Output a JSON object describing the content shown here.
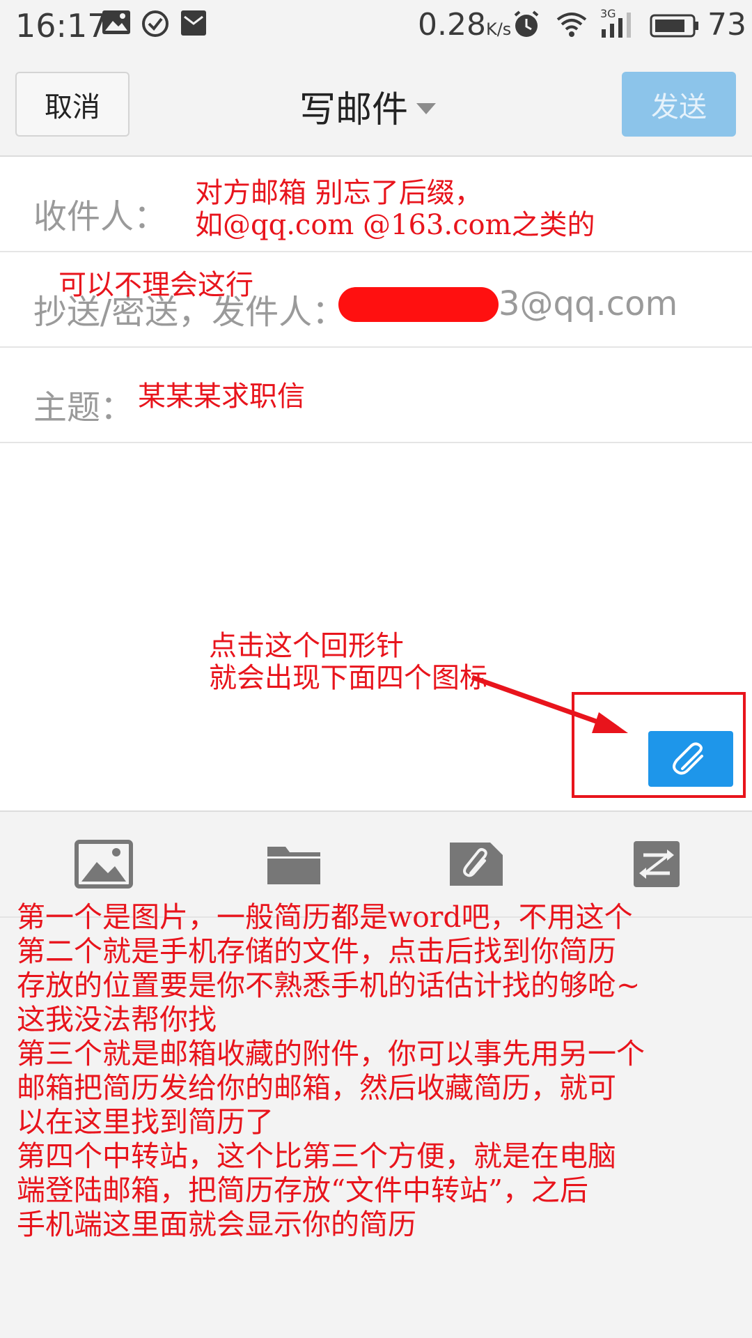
{
  "status_bar": {
    "time": "16:17",
    "net_speed": "0.28",
    "net_speed_unit": "K/s",
    "network_type": "3G",
    "battery_level": "73",
    "icons": [
      "image-icon",
      "check-circle-icon",
      "mail-notification-icon",
      "alarm-icon",
      "wifi-icon",
      "signal-icon",
      "battery-icon"
    ]
  },
  "top_bar": {
    "cancel_label": "取消",
    "title": "写邮件",
    "send_label": "发送"
  },
  "form": {
    "to_label": "收件人：",
    "cc_label": "抄送/密送，发件人：",
    "cc_value_visible": "3@qq.com",
    "subject_label": "主题："
  },
  "annotations": {
    "to_note": "对方邮箱 别忘了后缀，\n如@qq.com @163.com之类的",
    "cc_note": "可以不理会这行",
    "subject_note": "某某某求职信",
    "clip_note": "点击这个回形针\n就会出现下面四个图标",
    "bottom_note": "第一个是图片，一般简历都是word吧，不用这个\n第二个就是手机存储的文件，点击后找到你简历\n存放的位置要是你不熟悉手机的话估计找的够呛~\n这我没法帮你找\n第三个就是邮箱收藏的附件，你可以事先用另一个\n邮箱把简历发给你的邮箱，然后收藏简历，就可\n以在这里找到简历了\n第四个中转站，这个比第三个方便，就是在电脑\n端登陆邮箱，把简历存放“文件中转站”，之后\n手机端这里面就会显示你的简历"
  },
  "toolbar": {
    "icons": [
      "image-icon",
      "folder-icon",
      "favorite-attachment-icon",
      "transfer-station-icon"
    ]
  },
  "colors": {
    "annotation_red": "#e8141c",
    "send_button_disabled": "#8cc4ea",
    "attach_button": "#1e96ea"
  }
}
